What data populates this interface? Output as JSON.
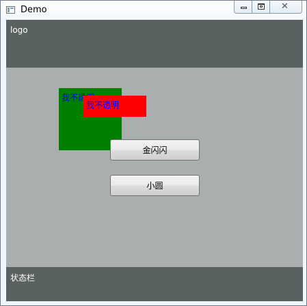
{
  "window": {
    "title": "Demo",
    "icons": {
      "app": "app-window-icon",
      "minimize": "minimize-icon",
      "maximize": "maximize-icon",
      "close": "close-icon"
    },
    "close_glyph": "✕"
  },
  "header": {
    "logo_text": "logo"
  },
  "overlay": {
    "green_box_text": "我不透明",
    "red_box_text": "我不透明"
  },
  "buttons": {
    "first_label": "金闪闪",
    "second_label": "小圆"
  },
  "status_bar": {
    "text": "状态栏"
  },
  "colors": {
    "band": "#5a6161",
    "content": "#a9afaf",
    "green": "#008000",
    "red": "#ff0000",
    "label_text": "#0000ff"
  }
}
